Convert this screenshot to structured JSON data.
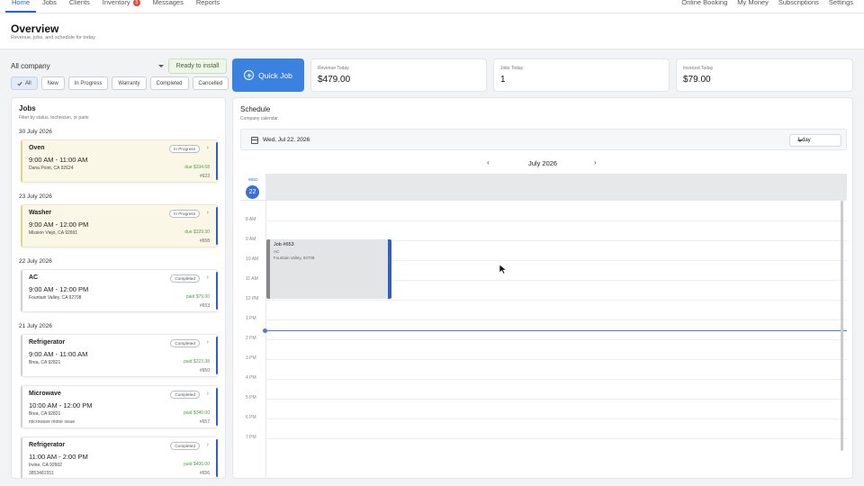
{
  "nav": {
    "left": [
      "Home",
      "Jobs",
      "Clients",
      "Inventory",
      "Messages",
      "Reports"
    ],
    "inventory_badge": "3",
    "right": [
      "Online Booking",
      "My Money",
      "Subscriptions",
      "Settings"
    ]
  },
  "header": {
    "title": "Overview",
    "subtitle": "Revenue, jobs, and schedule for today"
  },
  "company_select": {
    "value": "All company"
  },
  "install_button": "Ready to install",
  "filters": [
    "All",
    "New",
    "In Progress",
    "Warranty",
    "Completed",
    "Cancelled"
  ],
  "quick_job": "Quick Job",
  "stats": [
    {
      "label": "Revenue Today",
      "value": "$479.00"
    },
    {
      "label": "Jobs Today",
      "value": "1"
    },
    {
      "label": "Invoiced Today",
      "value": "$79.00"
    }
  ],
  "jobs": {
    "title": "Jobs",
    "subtitle": "Filter by status, technician, or parts",
    "groups": [
      {
        "date": "30 July 2026",
        "items": [
          {
            "name": "Oven",
            "status": "In Progress",
            "time": "9:00 AM - 11:00 AM",
            "address": "Dana Point, CA 92624",
            "extra": "",
            "payment": "due $334.68",
            "number": "#623"
          }
        ]
      },
      {
        "date": "23 July 2026",
        "items": [
          {
            "name": "Washer",
            "status": "In Progress",
            "time": "9:00 AM - 12:00 PM",
            "address": "Mission Viejo, CA 92691",
            "extra": "",
            "payment": "due $329.30",
            "number": "#658"
          }
        ]
      },
      {
        "date": "22 July 2026",
        "items": [
          {
            "name": "AC",
            "status": "Completed",
            "time": "9:00 AM - 12:00 PM",
            "address": "Fountain Valley, CA 92708",
            "extra": "",
            "payment": "paid $79.00",
            "number": "#653"
          }
        ]
      },
      {
        "date": "21 July 2026",
        "items": [
          {
            "name": "Refrigerator",
            "status": "Completed",
            "time": "9:00 AM - 11:00 AM",
            "address": "Brea, CA 92821",
            "extra": "",
            "payment": "paid $223.38",
            "number": "#650"
          },
          {
            "name": "Microwave",
            "status": "Completed",
            "time": "10:00 AM - 12:00 PM",
            "address": "Brea, CA 92821",
            "extra": "microwave motor issue",
            "payment": "paid $340.00",
            "number": "#657"
          },
          {
            "name": "Refrigerator",
            "status": "Completed",
            "time": "11:00 AM - 2:00 PM",
            "address": "Irvine, CA 92602",
            "extra": "3853481551",
            "payment": "paid $400.00",
            "number": "#656"
          }
        ]
      }
    ]
  },
  "schedule": {
    "title": "Schedule",
    "subtitle": "Company calendar.",
    "date": "Wed, Jul 22, 2026",
    "view": "1 day",
    "month": "July 2026",
    "day_name": "WED",
    "day_number": "22",
    "hours": [
      "8 AM",
      "9 AM",
      "10 AM",
      "11 AM",
      "12 PM",
      "1 PM",
      "2 PM",
      "3 PM",
      "4 PM",
      "5 PM",
      "6 PM",
      "7 PM"
    ],
    "event": {
      "title": "Job #653",
      "type": "AC",
      "address": "Fountain Valley, 92708"
    }
  },
  "icons": {
    "calendar": "calendar-icon",
    "prev": "chevron-left-icon",
    "next": "chevron-right-icon",
    "add": "plus-circle-icon",
    "check": "check-icon"
  },
  "colors": {
    "accent": "#3b82e0",
    "in_progress_bg": "#fbf7e6",
    "paid": "#4ea04c",
    "badge": "#e04a3f"
  }
}
